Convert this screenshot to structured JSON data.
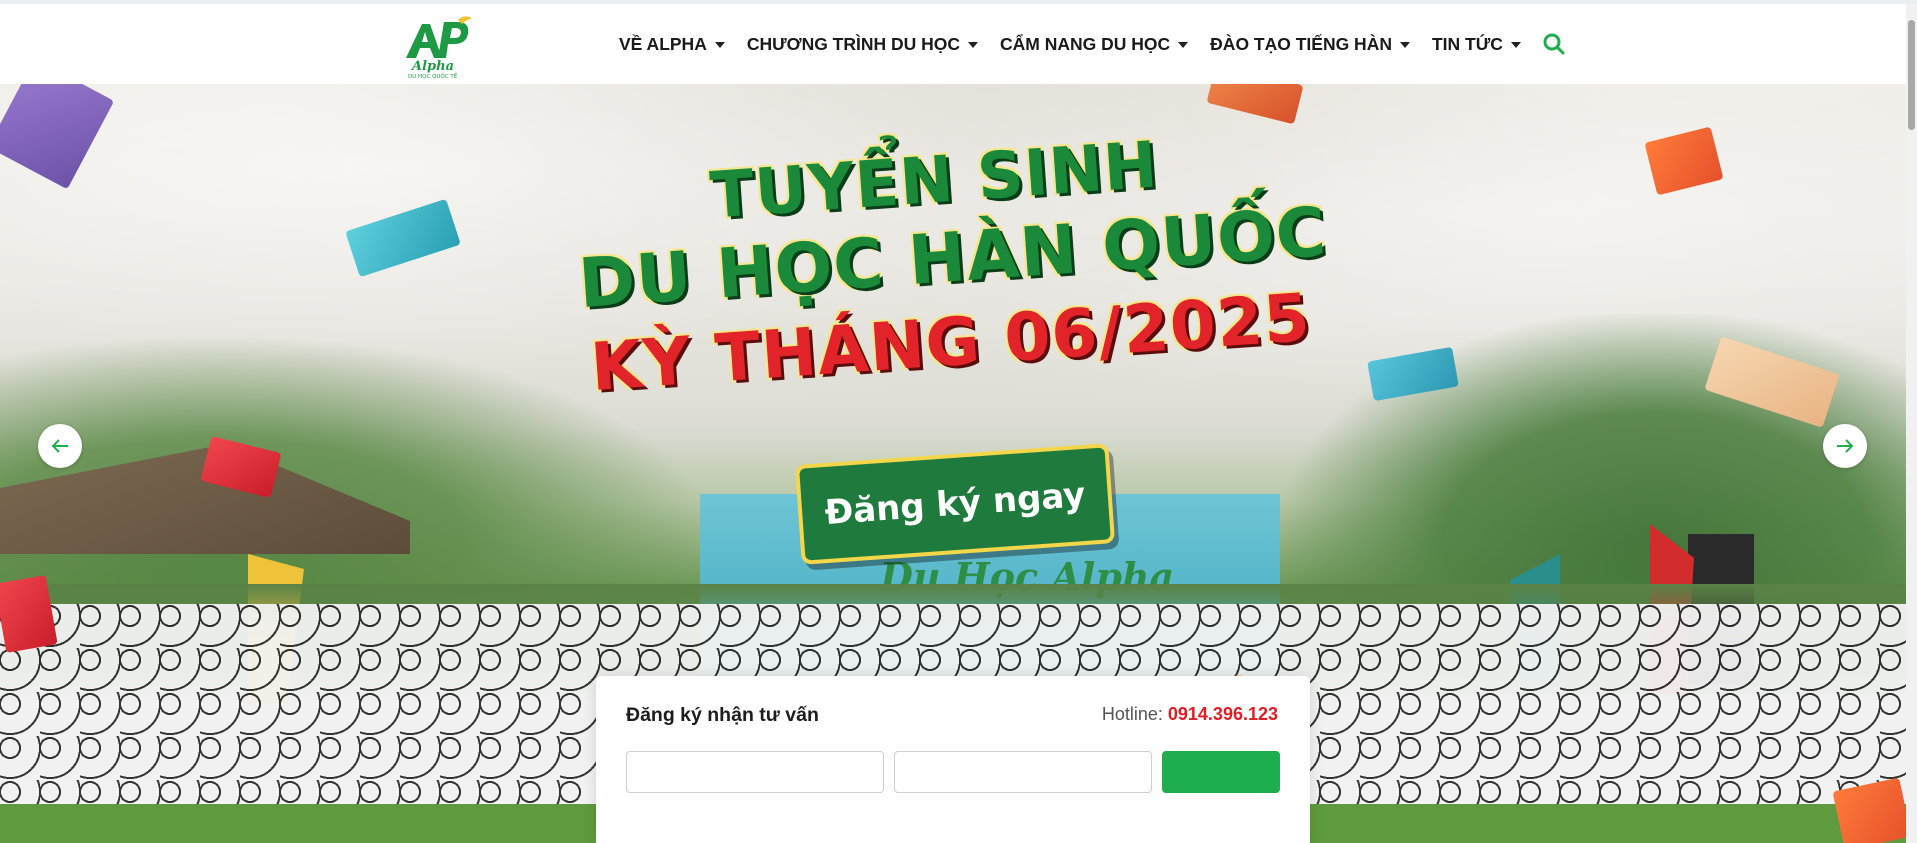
{
  "brand": {
    "logo_mark": "AP",
    "logo_name": "Alpha",
    "logo_tagline": "DU HỌC QUỐC TẾ",
    "primary_color": "#1eae4e",
    "accent_red": "#e31d24"
  },
  "nav": {
    "items": [
      {
        "label": "VỀ ALPHA"
      },
      {
        "label": "CHƯƠNG TRÌNH DU HỌC"
      },
      {
        "label": "CẨM NANG DU HỌC"
      },
      {
        "label": "ĐÀO TẠO TIẾNG HÀN"
      },
      {
        "label": "TIN TỨC"
      }
    ],
    "search_icon": "search-icon"
  },
  "hero": {
    "line1": "TUYỂN SINH",
    "line2": "DU HỌC HÀN QUỐC",
    "line3": "KỲ THÁNG 06/2025",
    "cta_label": "Đăng ký ngay",
    "banner_text": "Du Học Alpha",
    "prev_icon": "arrow-left-icon",
    "next_icon": "arrow-right-icon"
  },
  "form": {
    "title": "Đăng ký nhận tư vấn",
    "hotline_label": "Hotline:",
    "hotline_number": "0914.396.123"
  }
}
